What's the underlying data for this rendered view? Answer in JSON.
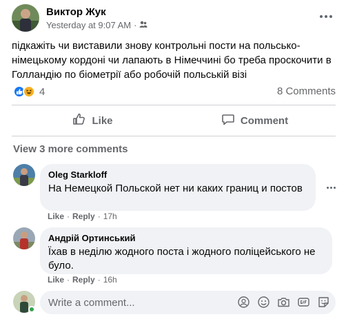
{
  "post": {
    "author": "Виктор Жук",
    "timestamp": "Yesterday at 9:07 AM",
    "separator": "·",
    "privacy_icon": "friends-icon",
    "text": "підкажіть чи виставили знову контрольні пости на польсько-німецькому кордоні чи лапають в Німеччині бо треба проскочити в Голландію по біометрії або робочій польській візі",
    "reaction_count": "4",
    "comments_count": "8 Comments"
  },
  "actions": {
    "like": "Like",
    "comment": "Comment"
  },
  "view_more": "View 3 more comments",
  "comments": [
    {
      "author": "Oleg Starkloff",
      "text": "На Немецкой Польской нет ни каких границ и постов",
      "like": "Like",
      "reply": "Reply",
      "time": "17h",
      "sep": "·"
    },
    {
      "author": "Андрій Ортинський",
      "text": "Їхав в неділю жодного поста і жодного поліцейського не було.",
      "like": "Like",
      "reply": "Reply",
      "time": "16h",
      "sep": "·"
    }
  ],
  "composer": {
    "placeholder": "Write a comment..."
  },
  "colors": {
    "brand": "#1877f2",
    "muted": "#65676b",
    "bubble": "#f0f2f5",
    "online": "#31a24c"
  }
}
